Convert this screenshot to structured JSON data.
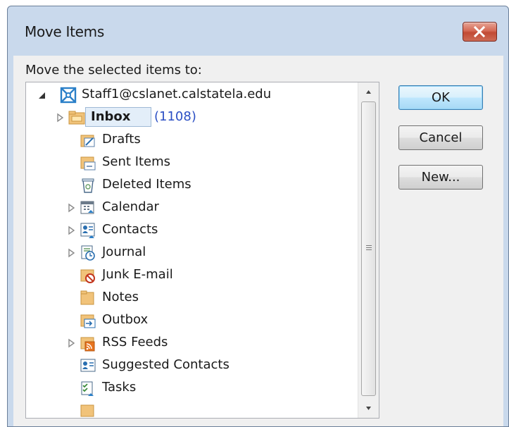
{
  "window": {
    "title": "Move Items"
  },
  "prompt": "Move the selected items to:",
  "buttons": {
    "ok": "OK",
    "cancel": "Cancel",
    "new": "New..."
  },
  "tree": {
    "account": "Staff1@cslanet.calstatela.edu",
    "folders": [
      {
        "label": "Inbox",
        "count": "(1108)",
        "icon": "inbox-folder-icon",
        "expandable": true,
        "selected": true
      },
      {
        "label": "Drafts",
        "icon": "drafts-folder-icon",
        "expandable": false
      },
      {
        "label": "Sent Items",
        "icon": "sent-items-folder-icon",
        "expandable": false
      },
      {
        "label": "Deleted Items",
        "icon": "deleted-items-icon",
        "expandable": false
      },
      {
        "label": "Calendar",
        "icon": "calendar-folder-icon",
        "expandable": true
      },
      {
        "label": "Contacts",
        "icon": "contacts-folder-icon",
        "expandable": true
      },
      {
        "label": "Journal",
        "icon": "journal-folder-icon",
        "expandable": true
      },
      {
        "label": "Junk E-mail",
        "icon": "junk-email-folder-icon",
        "expandable": false
      },
      {
        "label": "Notes",
        "icon": "notes-folder-icon",
        "expandable": false
      },
      {
        "label": "Outbox",
        "icon": "outbox-folder-icon",
        "expandable": false
      },
      {
        "label": "RSS Feeds",
        "icon": "rss-feeds-folder-icon",
        "expandable": true
      },
      {
        "label": "Suggested Contacts",
        "icon": "suggested-contacts-folder-icon",
        "expandable": false
      },
      {
        "label": "Tasks",
        "icon": "tasks-folder-icon",
        "expandable": false
      }
    ]
  },
  "colors": {
    "title_bar": "#c9d9ec",
    "close_button": "#c24a34",
    "unread_count": "#2b4fc4",
    "selection": "#e3eef9"
  }
}
